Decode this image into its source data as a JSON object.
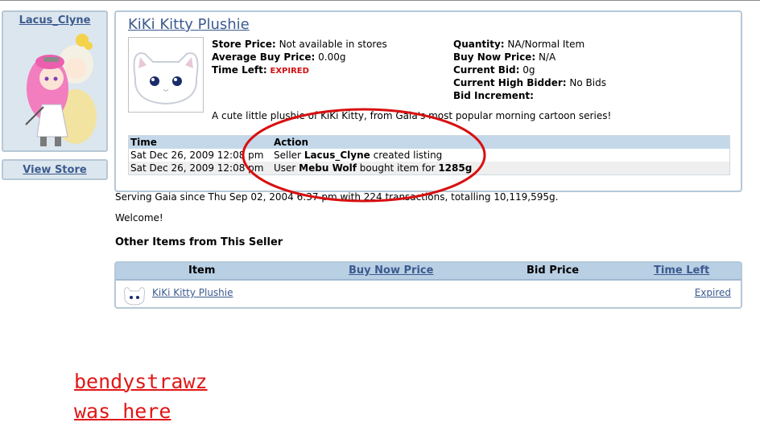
{
  "seller": {
    "name": "Lacus_Clyne",
    "view_store_label": "View Store"
  },
  "item": {
    "title": "KiKi Kitty Plushie",
    "store_price_label": "Store Price:",
    "store_price_value": "Not available in stores",
    "avg_buy_label": "Average Buy Price:",
    "avg_buy_value": "0.00g",
    "time_left_label": "Time Left:",
    "time_left_value": "EXPIRED",
    "quantity_label": "Quantity:",
    "quantity_value": "NA/Normal Item",
    "buy_now_label": "Buy Now Price:",
    "buy_now_value": "N/A",
    "current_bid_label": "Current Bid:",
    "current_bid_value": "0g",
    "high_bidder_label": "Current High Bidder:",
    "high_bidder_value": "No Bids",
    "bid_increment_label": "Bid Increment:",
    "description": "A cute little plushie of KiKi Kitty, from Gaia's most popular morning cartoon series!"
  },
  "history": {
    "headers": {
      "time": "Time",
      "action": "Action"
    },
    "rows": [
      {
        "time": "Sat Dec 26, 2009 12:08 pm",
        "pre": "Seller ",
        "who": "Lacus_Clyne",
        "post": " created listing",
        "amount": ""
      },
      {
        "time": "Sat Dec 26, 2009 12:08 pm",
        "pre": "User ",
        "who": "Mebu Wolf",
        "post": " bought item for ",
        "amount": "1285g"
      }
    ]
  },
  "serving_text": "Serving Gaia since Thu Sep 02, 2004 6:37 pm with 224 transactions, totalling 10,119,595g.",
  "welcome_text": "Welcome!",
  "other_items": {
    "title": "Other Items from This Seller",
    "headers": {
      "item": "Item",
      "buy_now": "Buy Now Price",
      "bid": "Bid Price",
      "time_left": "Time Left"
    },
    "rows": [
      {
        "name": "KiKi Kitty Plushie",
        "time_left": "Expired"
      }
    ]
  },
  "graffiti": {
    "line1": "bendystrawz",
    "line2": "was here"
  },
  "colors": {
    "link": "#3b5a8f",
    "panel_border": "#b6c8d6",
    "expired": "#d01010",
    "graffiti": "#e01818"
  }
}
